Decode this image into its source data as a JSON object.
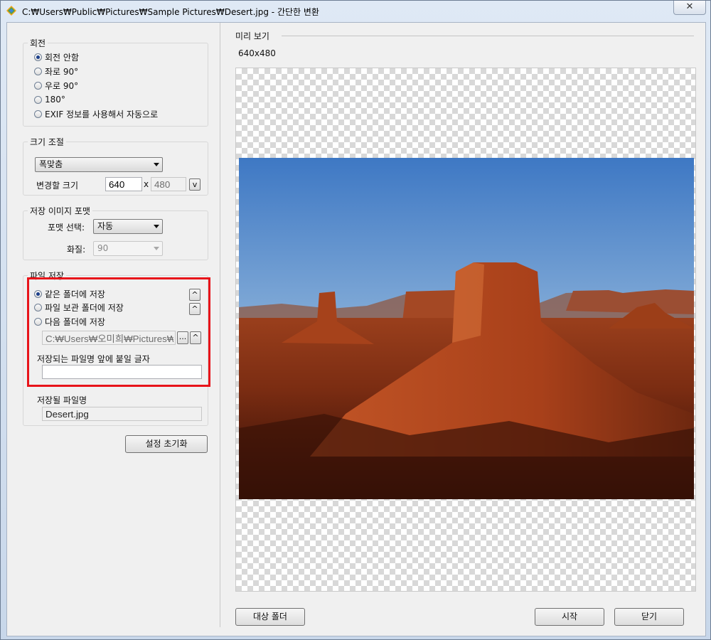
{
  "window": {
    "title": "C:₩Users₩Public₩Pictures₩Sample Pictures₩Desert.jpg - 간단한 변환",
    "close_glyph": "✕"
  },
  "rotation": {
    "legend": "회전",
    "options": [
      "회전 안함",
      "좌로 90°",
      "우로 90°",
      "180°",
      "EXIF 정보를 사용해서 자동으로"
    ],
    "selected_index": 0
  },
  "resize": {
    "legend": "크기 조절",
    "mode_value": "폭맞춤",
    "size_label": "변경할 크기",
    "width_value": "640",
    "x_separator": "x",
    "height_value": "480",
    "v_button_label": "v"
  },
  "format": {
    "legend": "저장 이미지 포맷",
    "format_label": "포맷 선택:",
    "format_value": "자동",
    "quality_label": "화질:",
    "quality_value": "90"
  },
  "save": {
    "legend": "파일 저장",
    "options": [
      "같은 폴더에 저장",
      "파일 보관 폴더에 저장",
      "다음 폴더에 저장"
    ],
    "selected_index": 0,
    "up_button_label": "^",
    "folder_path": "C:₩Users₩오미희₩Pictures₩꿀뷰",
    "browse_label": "...",
    "prefix_label": "저장되는 파일명 앞에 붙일 글자",
    "prefix_value": "",
    "saved_name_label": "저장될 파일명",
    "saved_name_value": "Desert.jpg"
  },
  "reset_button_label": "설정 초기화",
  "preview": {
    "title": "미리 보기",
    "dimensions": "640x480"
  },
  "buttons": {
    "target_folder": "대상 폴더",
    "start": "시작",
    "close": "닫기"
  },
  "colors": {
    "highlight": "#e8141a",
    "sky_top": "#3e78c4",
    "rock": "#b4471d"
  },
  "icons": {
    "app": "app-icon",
    "preview_image": "desert-photo"
  }
}
